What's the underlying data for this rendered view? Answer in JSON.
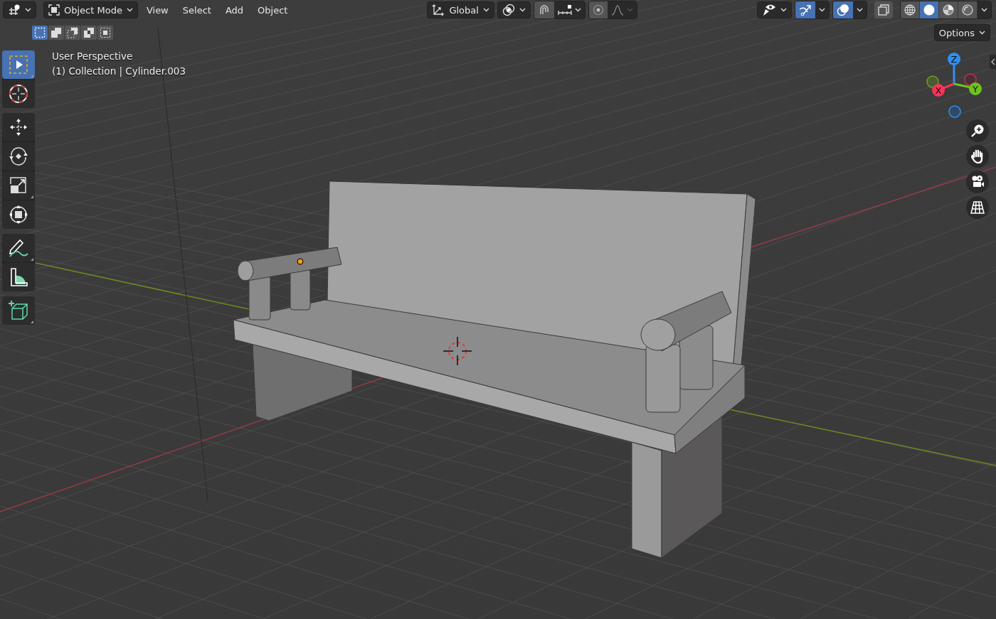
{
  "header": {
    "editor_type": {
      "kind": "view3d"
    },
    "mode": {
      "label": "Object Mode"
    },
    "menus": [
      "View",
      "Select",
      "Add",
      "Object"
    ],
    "orientation": {
      "label": "Global"
    },
    "snap": {
      "on": false
    },
    "proportional": {
      "on": false
    },
    "gizmos": {
      "on": true
    },
    "overlays": {
      "on": true
    },
    "xray": {
      "on": false
    },
    "shading_modes": [
      {
        "kind": "wireframe",
        "selected": false
      },
      {
        "kind": "solid",
        "selected": true
      },
      {
        "kind": "material",
        "selected": false
      },
      {
        "kind": "rendered",
        "selected": false
      }
    ]
  },
  "select_modes": [
    {
      "kind": "set",
      "selected": true
    },
    {
      "kind": "extend",
      "selected": false
    },
    {
      "kind": "subtract",
      "selected": false
    },
    {
      "kind": "difference",
      "selected": false
    },
    {
      "kind": "intersect",
      "selected": false
    }
  ],
  "options": {
    "label": "Options"
  },
  "viewport": {
    "view_name": "User Perspective",
    "object_info": "(1) Collection | Cylinder.003"
  },
  "tool_groups": [
    [
      {
        "kind": "select",
        "selected": true
      },
      {
        "kind": "cursor",
        "selected": false
      }
    ],
    [
      {
        "kind": "move",
        "selected": false
      },
      {
        "kind": "rotate",
        "selected": false
      },
      {
        "kind": "scale",
        "selected": false
      },
      {
        "kind": "transform",
        "selected": false
      }
    ],
    [
      {
        "kind": "annotate",
        "selected": false
      },
      {
        "kind": "measure",
        "selected": false
      }
    ],
    [
      {
        "kind": "add_cube",
        "selected": false
      }
    ]
  ],
  "gizmo_axes": [
    {
      "label": "Z",
      "color": "#2f8fef"
    },
    {
      "label": "X",
      "color": "#f33559"
    },
    {
      "label": "Y",
      "color": "#6fc31f"
    }
  ],
  "nav_buttons": [
    {
      "kind": "zoom"
    },
    {
      "kind": "pan"
    },
    {
      "kind": "camera"
    },
    {
      "kind": "ortho"
    }
  ]
}
